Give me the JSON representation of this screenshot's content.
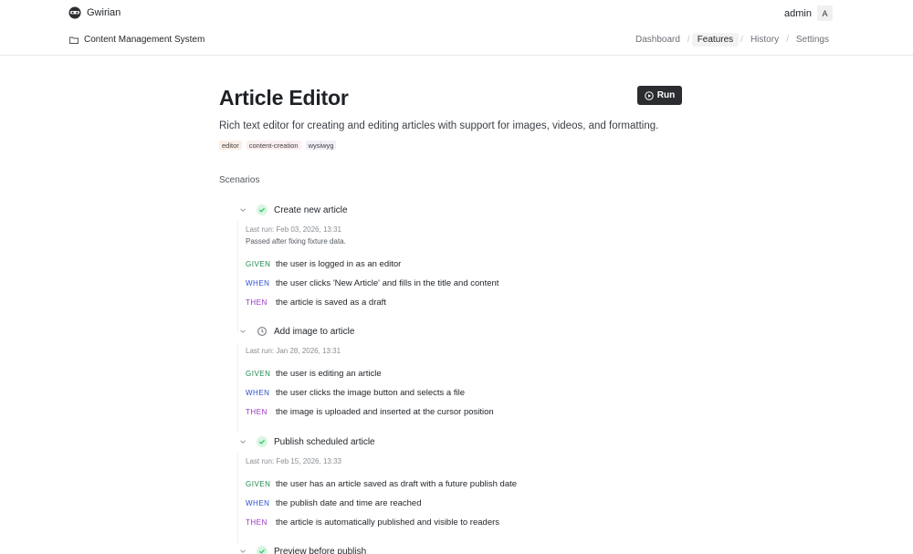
{
  "app": {
    "name": "Gwirian"
  },
  "user": {
    "name": "admin",
    "initial": "A"
  },
  "project": {
    "name": "Content Management System"
  },
  "nav": {
    "items": [
      "Dashboard",
      "Features",
      "History",
      "Settings"
    ],
    "active": "Features"
  },
  "feature": {
    "title": "Article Editor",
    "run_label": "Run",
    "description": "Rich text editor for creating and editing articles with support for images, videos, and formatting.",
    "tags": [
      "editor",
      "content-creation",
      "wysiwyg"
    ]
  },
  "scenarios_label": "Scenarios",
  "scenarios": [
    {
      "title": "Create new article",
      "status": "passed",
      "last_run": "Last run: Feb 03, 2026, 13:31",
      "note": "Passed after fixing fixture data.",
      "steps": [
        {
          "keyword": "GIVEN",
          "text": "the user is logged in as an editor"
        },
        {
          "keyword": "WHEN",
          "text": "the user clicks 'New Article' and fills in the title and content"
        },
        {
          "keyword": "THEN",
          "text": "the article is saved as a draft"
        }
      ]
    },
    {
      "title": "Add image to article",
      "status": "pending",
      "last_run": "Last run: Jan 28, 2026, 13:31",
      "steps": [
        {
          "keyword": "GIVEN",
          "text": "the user is editing an article"
        },
        {
          "keyword": "WHEN",
          "text": "the user clicks the image button and selects a file"
        },
        {
          "keyword": "THEN",
          "text": "the image is uploaded and inserted at the cursor position"
        }
      ]
    },
    {
      "title": "Publish scheduled article",
      "status": "passed",
      "last_run": "Last run: Feb 15, 2026, 13:33",
      "steps": [
        {
          "keyword": "GIVEN",
          "text": "the user has an article saved as draft with a future publish date"
        },
        {
          "keyword": "WHEN",
          "text": "the publish date and time are reached"
        },
        {
          "keyword": "THEN",
          "text": "the article is automatically published and visible to readers"
        }
      ]
    },
    {
      "title": "Preview before publish",
      "status": "passed"
    }
  ],
  "colors": {
    "given": "#1f8a4c",
    "when": "#2a4fd6",
    "then": "#9b33c8",
    "passed": "#22c55e",
    "run_button": "#2b2d31"
  },
  "icons": {
    "brand": "glasses-mask-icon",
    "project": "folder-icon",
    "run": "play-circle-icon",
    "expand": "chevron-down-icon",
    "passed": "check-circle-icon",
    "pending": "clock-icon"
  }
}
